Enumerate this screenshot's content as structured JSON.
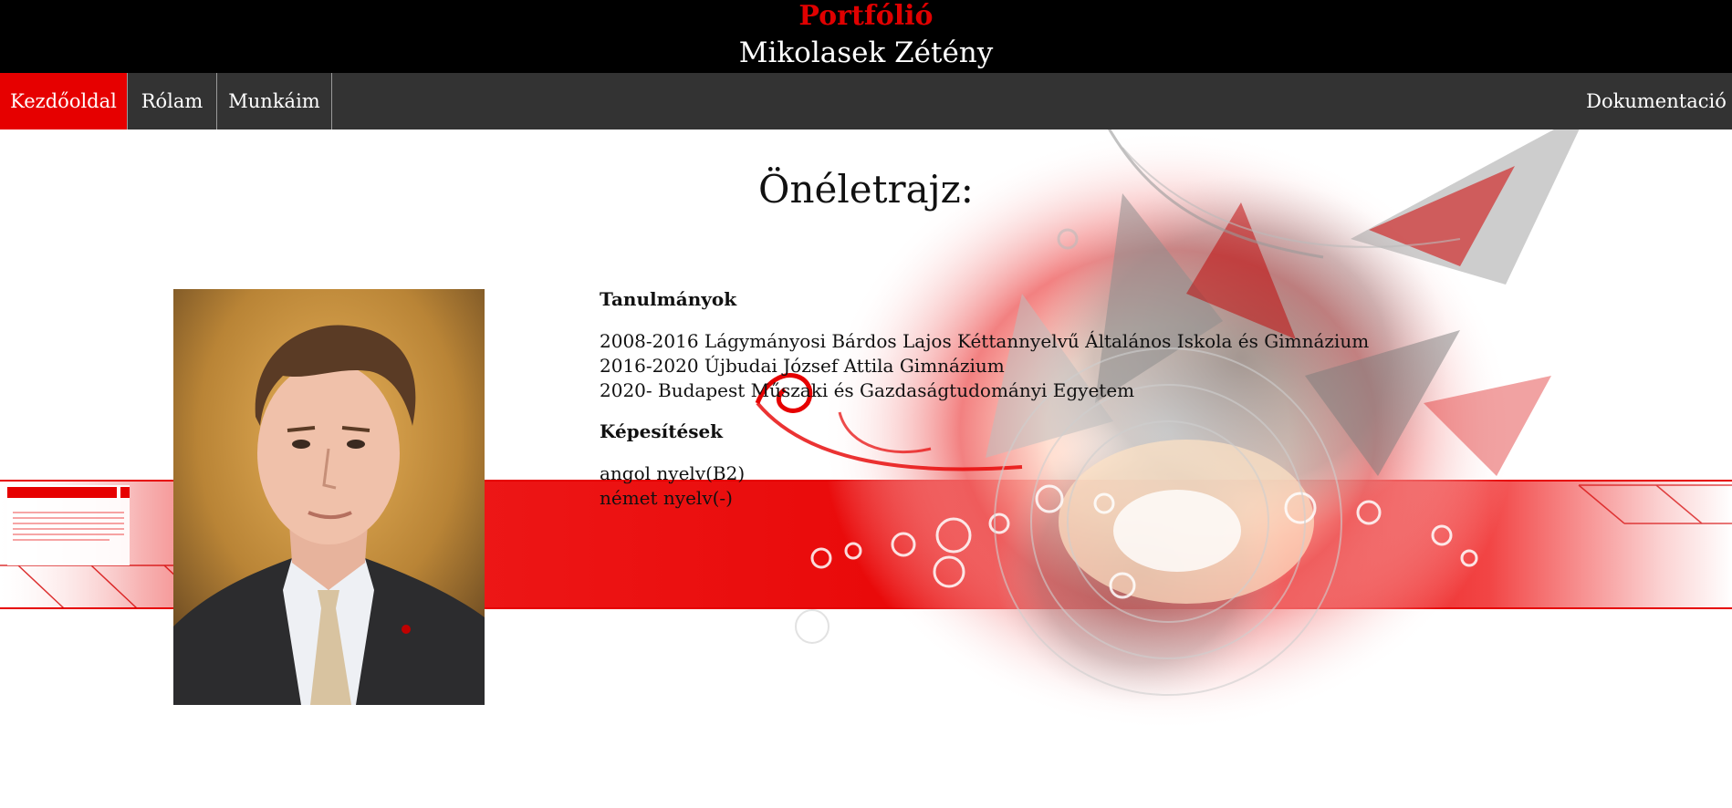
{
  "header": {
    "title": "Portfólió",
    "name": "Mikolasek Zétény"
  },
  "nav": {
    "items": [
      {
        "label": "Kezdőoldal",
        "active": true
      },
      {
        "label": "Rólam",
        "active": false
      },
      {
        "label": "Munkáim",
        "active": false
      }
    ],
    "right_label": "Dokumentació"
  },
  "main": {
    "heading": "Önéletrajz:",
    "studies": {
      "title": "Tanulmányok",
      "lines": [
        "2008-2016 Lágymányosi Bárdos Lajos Kéttannyelvű Általános Iskola és Gimnázium",
        "2016-2020 Újbudai József Attila Gimnázium",
        "2020- Budapest Műszaki és Gazdaságtudományi Egyetem"
      ]
    },
    "qualifications": {
      "title": "Képesítések",
      "lines": [
        "angol nyelv(B2)",
        "német nyelv(-)"
      ]
    }
  },
  "colors": {
    "header_bg": "#000000",
    "accent": "#e60000",
    "nav_bg": "#333333"
  }
}
